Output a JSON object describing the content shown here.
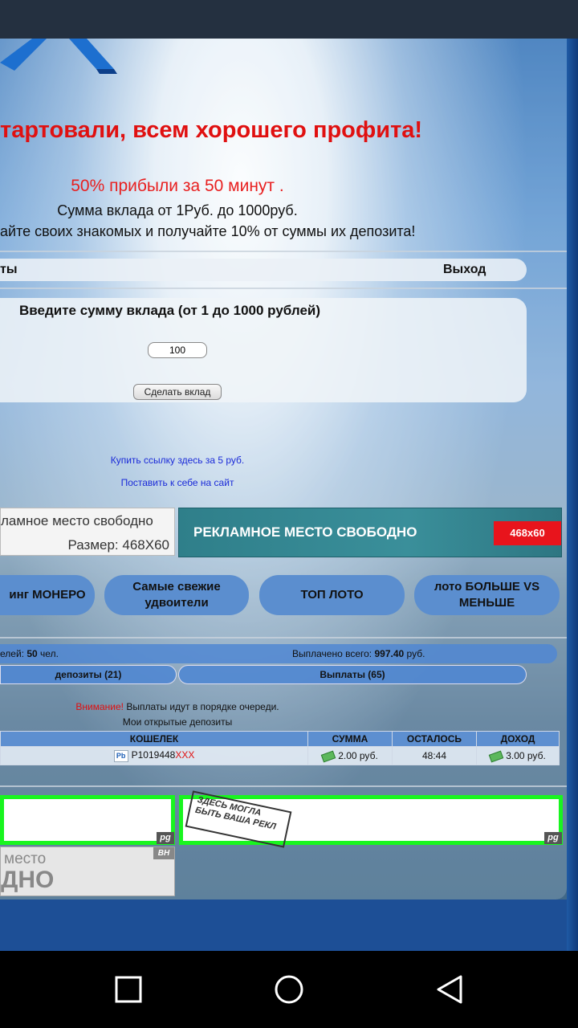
{
  "header": {
    "headline": "тартовали, всем хорошего профита!",
    "promo": "50% прибыли за 50 минут .",
    "range": "Сумма вклада от 1Руб. до 1000руб.",
    "referral": "айте своих знакомых и получайте 10% от суммы их депозита!"
  },
  "menu": {
    "left": "ты",
    "logout": "Выход"
  },
  "deposit": {
    "title": "Введите сумму вклада (от 1 до 1000 рублей)",
    "amount": "100",
    "button": "Сделать вклад"
  },
  "links": {
    "buy": "Купить ссылку здесь за 5 руб.",
    "place": "Поставить к себе на сайт"
  },
  "ads": {
    "left_line1": "ламное место свободно",
    "left_line2": "Размер: 468X60",
    "right_text": "РЕКЛАМНОЕ  МЕСТО СВОБОДНО",
    "right_size": "468x60"
  },
  "nav_buttons": [
    "инг МОНЕРО",
    "Самые свежие удвоители",
    "ТОП ЛОТО",
    "лото БОЛЬШЕ VS МЕНЬШЕ"
  ],
  "stats": {
    "users_label": "елей:",
    "users_value": "50",
    "users_unit": "чел.",
    "paid_label": "Выплачено всего:",
    "paid_value": "997.40",
    "paid_unit": "руб."
  },
  "tabs": {
    "deposits": "депозиты (21)",
    "payouts": "Выплаты (65)"
  },
  "notice": {
    "warning_word": "Внимание!",
    "warning_text": " Выплаты идут в порядке очереди.",
    "opened": "Мои открытые депозиты"
  },
  "table": {
    "headers": [
      "КОШЕЛЕК",
      "СУММА",
      "ОСТАЛОСЬ",
      "ДОХОД"
    ],
    "rows": [
      {
        "wallet": "P1019448",
        "wallet_mask": "XXX",
        "amount": "2.00 руб.",
        "left": "48:44",
        "income": "3.00 руб."
      }
    ]
  },
  "banners": {
    "pg_tag": "pg",
    "stamp_text": "ЗДЕСЬ МОГЛА БЫТЬ ВАША РЕКЛ",
    "bottom_line1": "место",
    "bottom_line2": "ДНО",
    "bh_tag": "BH"
  },
  "colors": {
    "headline_red": "#e01010",
    "nav_blue": "#5b8ecf",
    "banner_green": "#19f51f",
    "ad_teal": "#2f7f8a"
  },
  "icons": [
    "pb-icon",
    "money-icon",
    "square-nav-icon",
    "circle-nav-icon",
    "back-nav-icon"
  ]
}
